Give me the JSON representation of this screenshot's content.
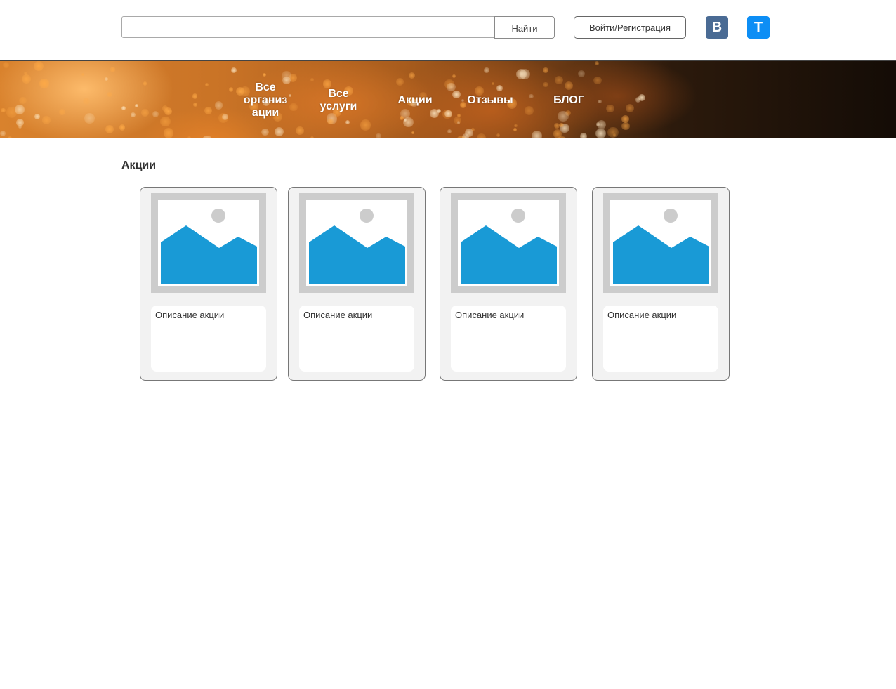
{
  "header": {
    "search_placeholder": "",
    "search_button_label": "Найти",
    "login_button_label": "Войти/Регистрация",
    "social": [
      {
        "letter": "В",
        "icon": "vk-icon",
        "color": "#4a6b94"
      },
      {
        "letter": "T",
        "icon": "t-icon",
        "color": "#0d8ef5"
      }
    ]
  },
  "nav": {
    "items": [
      {
        "label": "Все\nорганиз\nации"
      },
      {
        "label": "Все\nуслуги"
      },
      {
        "label": "Акции"
      },
      {
        "label": "Отзывы"
      },
      {
        "label": "БЛОГ"
      }
    ]
  },
  "main": {
    "section_title": "Акции",
    "cards": [
      {
        "image_icon": "image-placeholder-icon",
        "description": "Описание акции"
      },
      {
        "image_icon": "image-placeholder-icon",
        "description": "Описание акции"
      },
      {
        "image_icon": "image-placeholder-icon",
        "description": "Описание акции"
      },
      {
        "image_icon": "image-placeholder-icon",
        "description": "Описание акции"
      }
    ]
  },
  "colors": {
    "placeholder_blue": "#199ad6",
    "placeholder_sun": "#cccccc",
    "card_bg": "#f2f2f2"
  }
}
